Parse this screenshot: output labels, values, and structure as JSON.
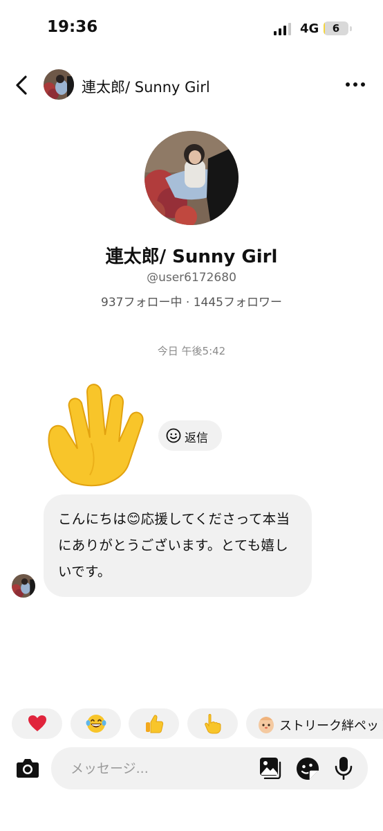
{
  "status_bar": {
    "time": "19:36",
    "network": "4G",
    "battery": "6",
    "battery_level": 0.06
  },
  "header": {
    "title": "連太郎/ Sunny Girl",
    "back_icon": "chevron-left-icon",
    "more_icon": "more-horizontal-icon"
  },
  "profile": {
    "name": "連太郎/ Sunny Girl",
    "handle": "@user6172680",
    "stats": "937フォロー中 · 1445フォロワー"
  },
  "conversation": {
    "timestamp": "今日 午後5:42",
    "wave_icon": "waving-hand-icon",
    "reply_label": "返信",
    "message": "こんにちは😊応援してくださって本当にありがとうございます。とても嬉しいです。"
  },
  "quick_reactions": {
    "items": [
      "heart-icon",
      "laughing-tears-icon",
      "thumbs-up-icon",
      "pointing-hand-icon"
    ],
    "streak_label": "ストリーク絆ペット"
  },
  "composer": {
    "placeholder": "メッセージ...",
    "camera_icon": "camera-icon",
    "image_icon": "image-icon",
    "sticker_icon": "sticker-icon",
    "mic_icon": "microphone-icon"
  },
  "colors": {
    "bubble_bg": "#f1f1f1",
    "muted_text": "#8a8a8a",
    "emoji_yellow": "#f8c52a",
    "heart_red": "#e0243c"
  }
}
